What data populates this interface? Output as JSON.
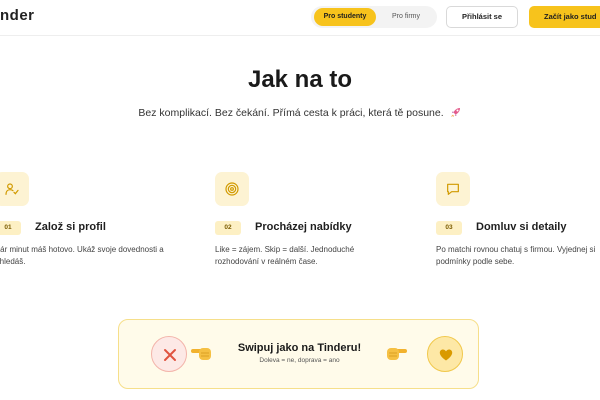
{
  "header": {
    "logo": "nder",
    "toggle": {
      "active": "Pro studenty",
      "inactive": "Pro firmy"
    },
    "login_label": "Přihlásit se",
    "start_label": "Začít jako stud"
  },
  "hero": {
    "title": "Jak na to",
    "subtitle": "Bez komplikací. Bez čekání. Přímá cesta k práci, která tě posune."
  },
  "steps": [
    {
      "number": "01",
      "icon": "user-check-icon",
      "title": "Založ si profil",
      "description": "a pár minut máš hotovo. Ukáž svoje dovednosti a co hledáš."
    },
    {
      "number": "02",
      "icon": "target-icon",
      "title": "Procházej nabídky",
      "description": "Like = zájem. Skip = další. Jednoduché rozhodování v reálném čase."
    },
    {
      "number": "03",
      "icon": "chat-icon",
      "title": "Domluv si detaily",
      "description": "Po matchi rovnou chatuj s firmou. Vyjednej si podmínky podle sebe."
    }
  ],
  "swipe": {
    "title": "Swipuj jako na Tinderu!",
    "hint": "Doleva = ne, doprava = ano",
    "reject_icon": "close-icon",
    "like_icon": "heart-icon"
  },
  "colors": {
    "accent": "#f7c31c",
    "banner_bg": "#fffbea",
    "reject_bg": "#fde9e6"
  }
}
